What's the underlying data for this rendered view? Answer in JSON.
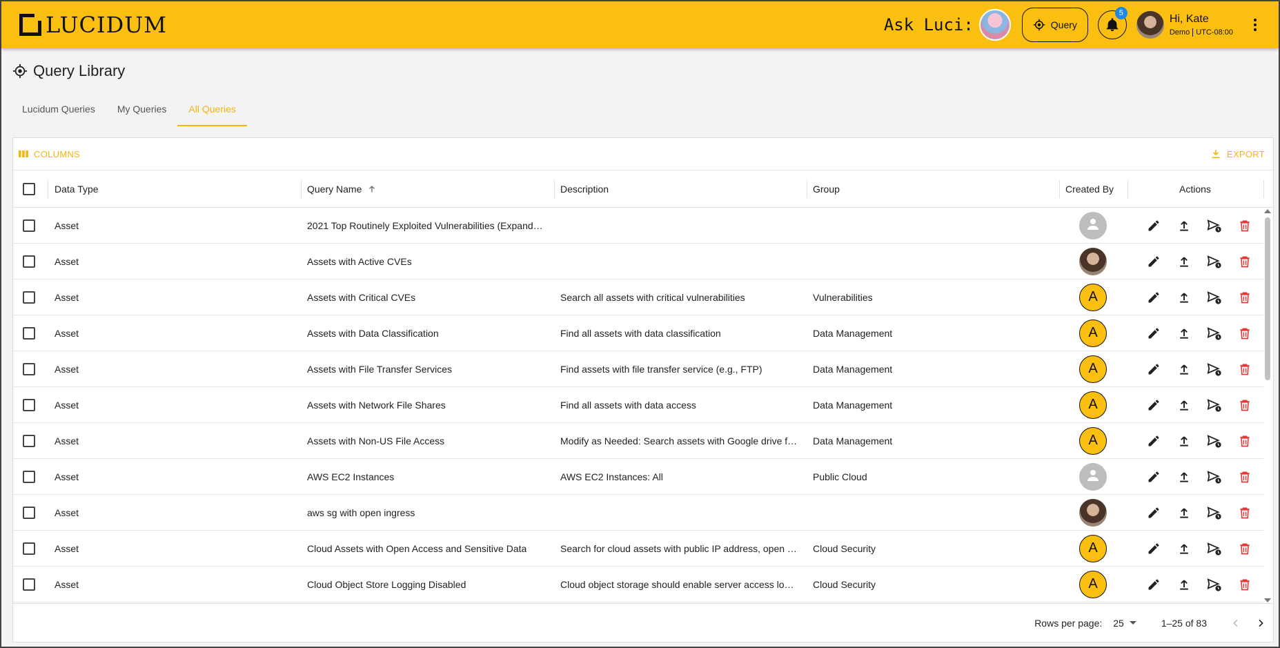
{
  "header": {
    "logo_text": "LUCIDUM",
    "ask_luci": "Ask Luci:",
    "query_button": "Query",
    "notification_count": "5",
    "greeting": "Hi, Kate",
    "org": "Demo",
    "timezone": "UTC-08:00",
    "brand_color": "#fbbf12"
  },
  "page": {
    "title": "Query Library",
    "tabs": [
      "Lucidum Queries",
      "My Queries",
      "All Queries"
    ],
    "active_tab": "All Queries"
  },
  "toolbar": {
    "columns_label": "COLUMNS",
    "export_label": "EXPORT"
  },
  "table": {
    "columns": {
      "data_type": "Data Type",
      "query_name": "Query Name",
      "description": "Description",
      "group": "Group",
      "created_by": "Created By",
      "actions": "Actions"
    },
    "sort": {
      "column": "Query Name",
      "direction": "asc"
    },
    "rows": [
      {
        "data_type": "Asset",
        "query_name": "2021 Top Routinely Exploited Vulnerabilities (Expand…",
        "description": "",
        "group": "",
        "creator": {
          "kind": "default",
          "letter": ""
        }
      },
      {
        "data_type": "Asset",
        "query_name": "Assets with Active CVEs",
        "description": "",
        "group": "",
        "creator": {
          "kind": "photo",
          "letter": ""
        }
      },
      {
        "data_type": "Asset",
        "query_name": "Assets with Critical CVEs",
        "description": "Search all assets with critical vulnerabilities",
        "group": "Vulnerabilities",
        "creator": {
          "kind": "letter",
          "letter": "A"
        }
      },
      {
        "data_type": "Asset",
        "query_name": "Assets with Data Classification",
        "description": "Find all assets with data classification",
        "group": "Data Management",
        "creator": {
          "kind": "letter",
          "letter": "A"
        }
      },
      {
        "data_type": "Asset",
        "query_name": "Assets with File Transfer Services",
        "description": "Find assets with file transfer service (e.g., FTP)",
        "group": "Data Management",
        "creator": {
          "kind": "letter",
          "letter": "A"
        }
      },
      {
        "data_type": "Asset",
        "query_name": "Assets with Network File Shares",
        "description": "Find all assets with data access",
        "group": "Data Management",
        "creator": {
          "kind": "letter",
          "letter": "A"
        }
      },
      {
        "data_type": "Asset",
        "query_name": "Assets with Non-US File Access",
        "description": "Modify as Needed: Search assets with Google drive f…",
        "group": "Data Management",
        "creator": {
          "kind": "letter",
          "letter": "A"
        }
      },
      {
        "data_type": "Asset",
        "query_name": "AWS EC2 Instances",
        "description": "AWS EC2 Instances: All",
        "group": "Public Cloud",
        "creator": {
          "kind": "default",
          "letter": ""
        }
      },
      {
        "data_type": "Asset",
        "query_name": "aws sg with open ingress",
        "description": "",
        "group": "",
        "creator": {
          "kind": "photo",
          "letter": ""
        }
      },
      {
        "data_type": "Asset",
        "query_name": "Cloud Assets with Open Access and Sensitive Data",
        "description": "Search for cloud assets with public IP address, open …",
        "group": "Cloud Security",
        "creator": {
          "kind": "letter",
          "letter": "A"
        }
      },
      {
        "data_type": "Asset",
        "query_name": "Cloud Object Store Logging Disabled",
        "description": "Cloud object storage should enable server access lo…",
        "group": "Cloud Security",
        "creator": {
          "kind": "letter",
          "letter": "A"
        }
      }
    ]
  },
  "pagination": {
    "rows_per_page_label": "Rows per page:",
    "rows_per_page": "25",
    "range": "1–25 of 83"
  },
  "colors": {
    "accent": "#f5b50a",
    "delete": "#e53935"
  }
}
